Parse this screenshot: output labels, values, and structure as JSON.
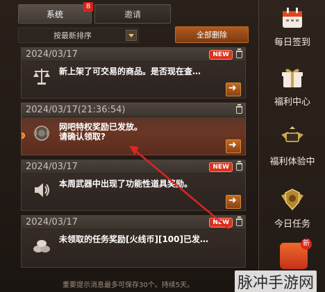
{
  "tabs": {
    "system_label": "系统",
    "system_badge": "8",
    "invite_label": "邀请"
  },
  "toolbar": {
    "sort_label": "按最新排序",
    "delete_all_label": "全部删除"
  },
  "messages": [
    {
      "date": "2024/03/17",
      "text": "新上架了可交易的商品。是否现在查…",
      "new_badge": "NEW",
      "icon": "scale-icon"
    },
    {
      "date": "2024/03/17(21:36:54)",
      "text_line1": "网吧特权奖励已发放。",
      "text_line2": "请确认领取?",
      "icon": "medal-icon"
    },
    {
      "date": "2024/03/17",
      "text": "本周武器中出现了功能性道具奖励。",
      "new_badge": "NEW",
      "icon": "speaker-icon"
    },
    {
      "date": "2024/03/17",
      "text": "未领取的任务奖励[火线币][100]已发…",
      "new_badge": "NEW",
      "icon": "coins-icon"
    }
  ],
  "footer_note": "重要提示消息最多可保存30个。持续5天。",
  "sidebar": {
    "items": [
      {
        "label": "每日签到",
        "icon": "calendar-icon"
      },
      {
        "label": "福利中心",
        "icon": "gift-icon"
      },
      {
        "label": "福利体验中",
        "icon": "wing-badge-icon"
      },
      {
        "label": "今日任务",
        "icon": "shield-badge-icon"
      }
    ],
    "bottom_badge": "新"
  },
  "watermark": "脉冲手游网",
  "colors": {
    "accent_orange": "#c26a22",
    "new_badge": "#d8321f",
    "annotation_arrow": "#e0241f"
  }
}
